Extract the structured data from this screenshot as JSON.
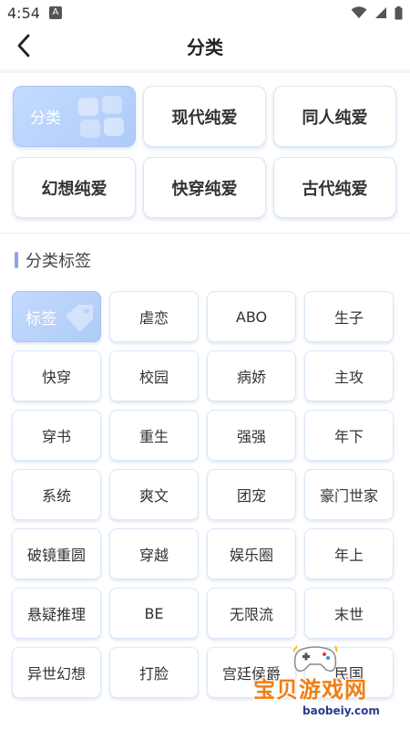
{
  "status": {
    "time": "4:54",
    "badge": "A"
  },
  "header": {
    "title": "分类"
  },
  "categories": [
    {
      "label": "分类",
      "active": true
    },
    {
      "label": "现代纯爱",
      "active": false
    },
    {
      "label": "同人纯爱",
      "active": false
    },
    {
      "label": "幻想纯爱",
      "active": false
    },
    {
      "label": "快穿纯爱",
      "active": false
    },
    {
      "label": "古代纯爱",
      "active": false
    }
  ],
  "section": {
    "title": "分类标签"
  },
  "tags": [
    {
      "label": "标签",
      "active": true
    },
    {
      "label": "虐恋"
    },
    {
      "label": "ABO"
    },
    {
      "label": "生子"
    },
    {
      "label": "快穿"
    },
    {
      "label": "校园"
    },
    {
      "label": "病娇"
    },
    {
      "label": "主攻"
    },
    {
      "label": "穿书"
    },
    {
      "label": "重生"
    },
    {
      "label": "强强"
    },
    {
      "label": "年下"
    },
    {
      "label": "系统"
    },
    {
      "label": "爽文"
    },
    {
      "label": "团宠"
    },
    {
      "label": "豪门世家"
    },
    {
      "label": "破镜重圆"
    },
    {
      "label": "穿越"
    },
    {
      "label": "娱乐圈"
    },
    {
      "label": "年上"
    },
    {
      "label": "悬疑推理"
    },
    {
      "label": "BE"
    },
    {
      "label": "无限流"
    },
    {
      "label": "末世"
    },
    {
      "label": "异世幻想"
    },
    {
      "label": "打脸"
    },
    {
      "label": "宫廷侯爵"
    },
    {
      "label": "民国"
    }
  ],
  "watermark": {
    "main": "宝贝游戏网",
    "sub": "baobeiy.com"
  },
  "colors": {
    "accent": "#87a7e6",
    "active_card": "#b7d1fb",
    "watermark": "#f07f13"
  }
}
